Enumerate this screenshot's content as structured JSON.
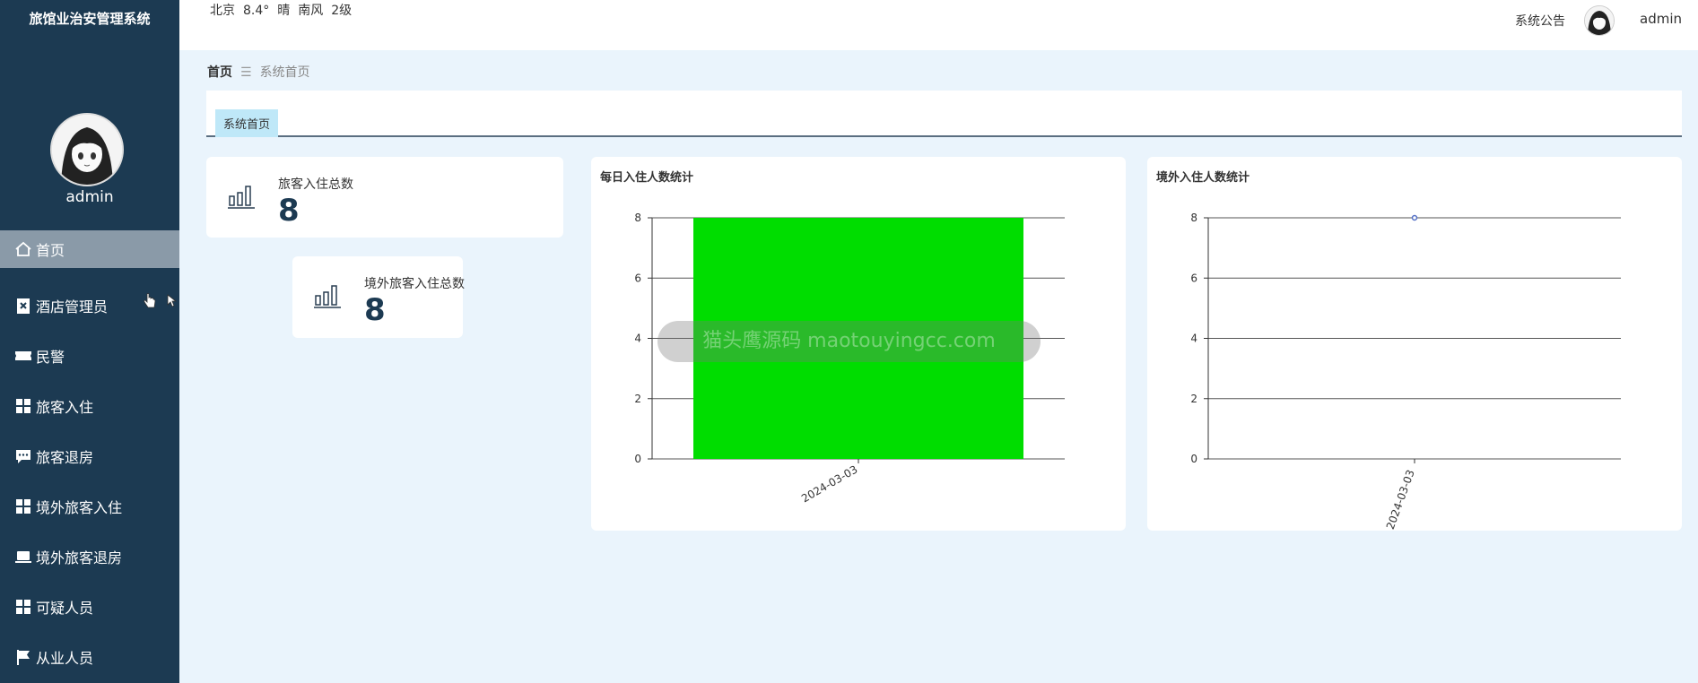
{
  "app": {
    "title": "旅馆业治安管理系统"
  },
  "profile": {
    "name": "admin"
  },
  "menu": [
    {
      "label": "首页",
      "icon": "home-icon"
    },
    {
      "label": "酒店管理员",
      "icon": "clipboard-icon"
    },
    {
      "label": "民警",
      "icon": "ticket-icon"
    },
    {
      "label": "旅客入住",
      "icon": "grid-icon"
    },
    {
      "label": "旅客退房",
      "icon": "chat-icon"
    },
    {
      "label": "境外旅客入住",
      "icon": "grid-icon"
    },
    {
      "label": "境外旅客退房",
      "icon": "laptop-icon"
    },
    {
      "label": "可疑人员",
      "icon": "grid-icon"
    },
    {
      "label": "从业人员",
      "icon": "flag-icon"
    }
  ],
  "topbar": {
    "weather": {
      "city": "北京",
      "temp": "8.4°",
      "condition": "晴",
      "wind": "南风",
      "level": "2级"
    },
    "notice": "系统公告",
    "user": "admin"
  },
  "breadcrumb": {
    "home": "首页",
    "separator": "☰",
    "current": "系统首页"
  },
  "tabs": {
    "active": "系统首页"
  },
  "stats": [
    {
      "label": "旅客入住总数",
      "value": "8"
    },
    {
      "label": "境外旅客入住总数",
      "value": "8"
    }
  ],
  "chart_data": [
    {
      "type": "bar",
      "title": "每日入住人数统计",
      "categories": [
        "2024-03-03"
      ],
      "values": [
        8
      ],
      "ylim": [
        0,
        8
      ],
      "yticks": [
        0,
        2,
        4,
        6,
        8
      ],
      "grid": true,
      "color": "#00dd00"
    },
    {
      "type": "line",
      "title": "境外入住人数统计",
      "categories": [
        "2024-03-03"
      ],
      "values": [
        8
      ],
      "ylim": [
        0,
        8
      ],
      "yticks": [
        0,
        2,
        4,
        6,
        8
      ],
      "grid": true,
      "color": "#5470c6"
    }
  ],
  "watermark": "猫头鹰源码 maotouyingcc.com"
}
